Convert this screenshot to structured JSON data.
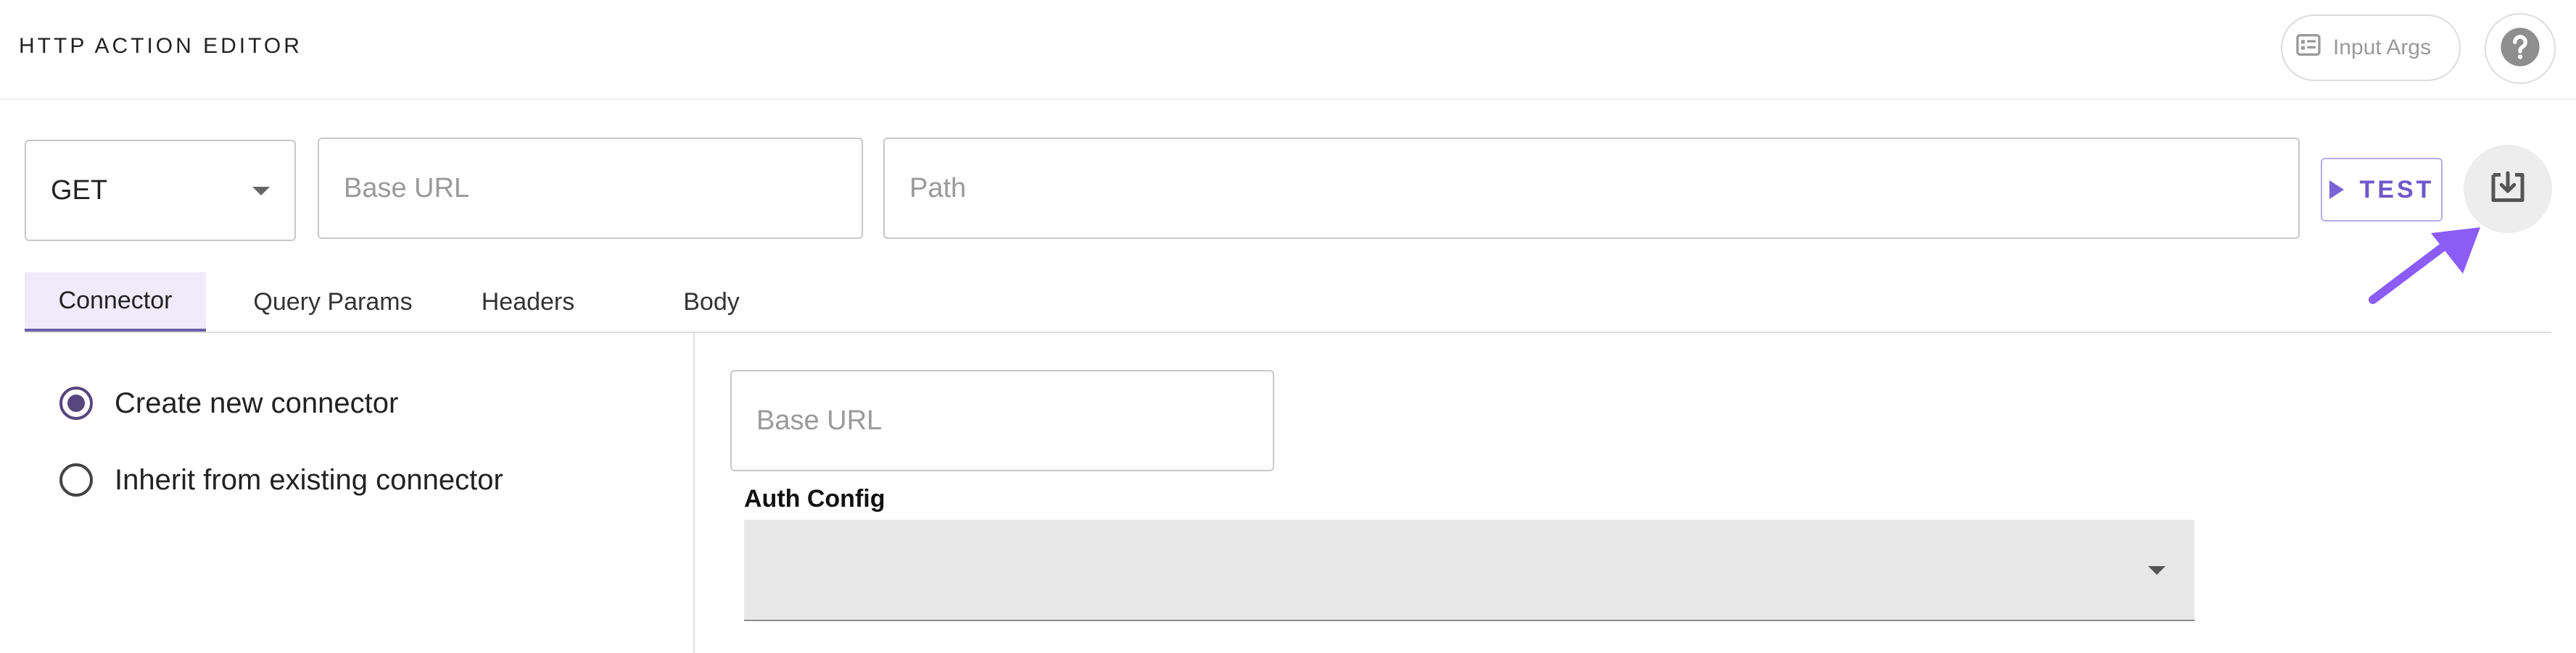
{
  "header": {
    "title": "HTTP ACTION EDITOR",
    "input_args_label": "Input Args",
    "help_icon": "help-circle-icon"
  },
  "request": {
    "method": "GET",
    "base_url_placeholder": "Base URL",
    "path_placeholder": "Path",
    "test_label": "TEST",
    "download_icon": "download-icon"
  },
  "tabs": [
    {
      "label": "Connector",
      "active": true
    },
    {
      "label": "Query Params",
      "active": false
    },
    {
      "label": "Headers",
      "active": false
    },
    {
      "label": "Body",
      "active": false
    }
  ],
  "connector": {
    "options": [
      {
        "label": "Create new connector",
        "checked": true
      },
      {
        "label": "Inherit from existing connector",
        "checked": false
      }
    ],
    "base_url_placeholder": "Base URL",
    "auth_label": "Auth Config",
    "auth_value": ""
  },
  "colors": {
    "accent": "#6f58c9",
    "annotation_arrow": "#8b5cf6",
    "tab_active_bg": "#efebfb"
  }
}
